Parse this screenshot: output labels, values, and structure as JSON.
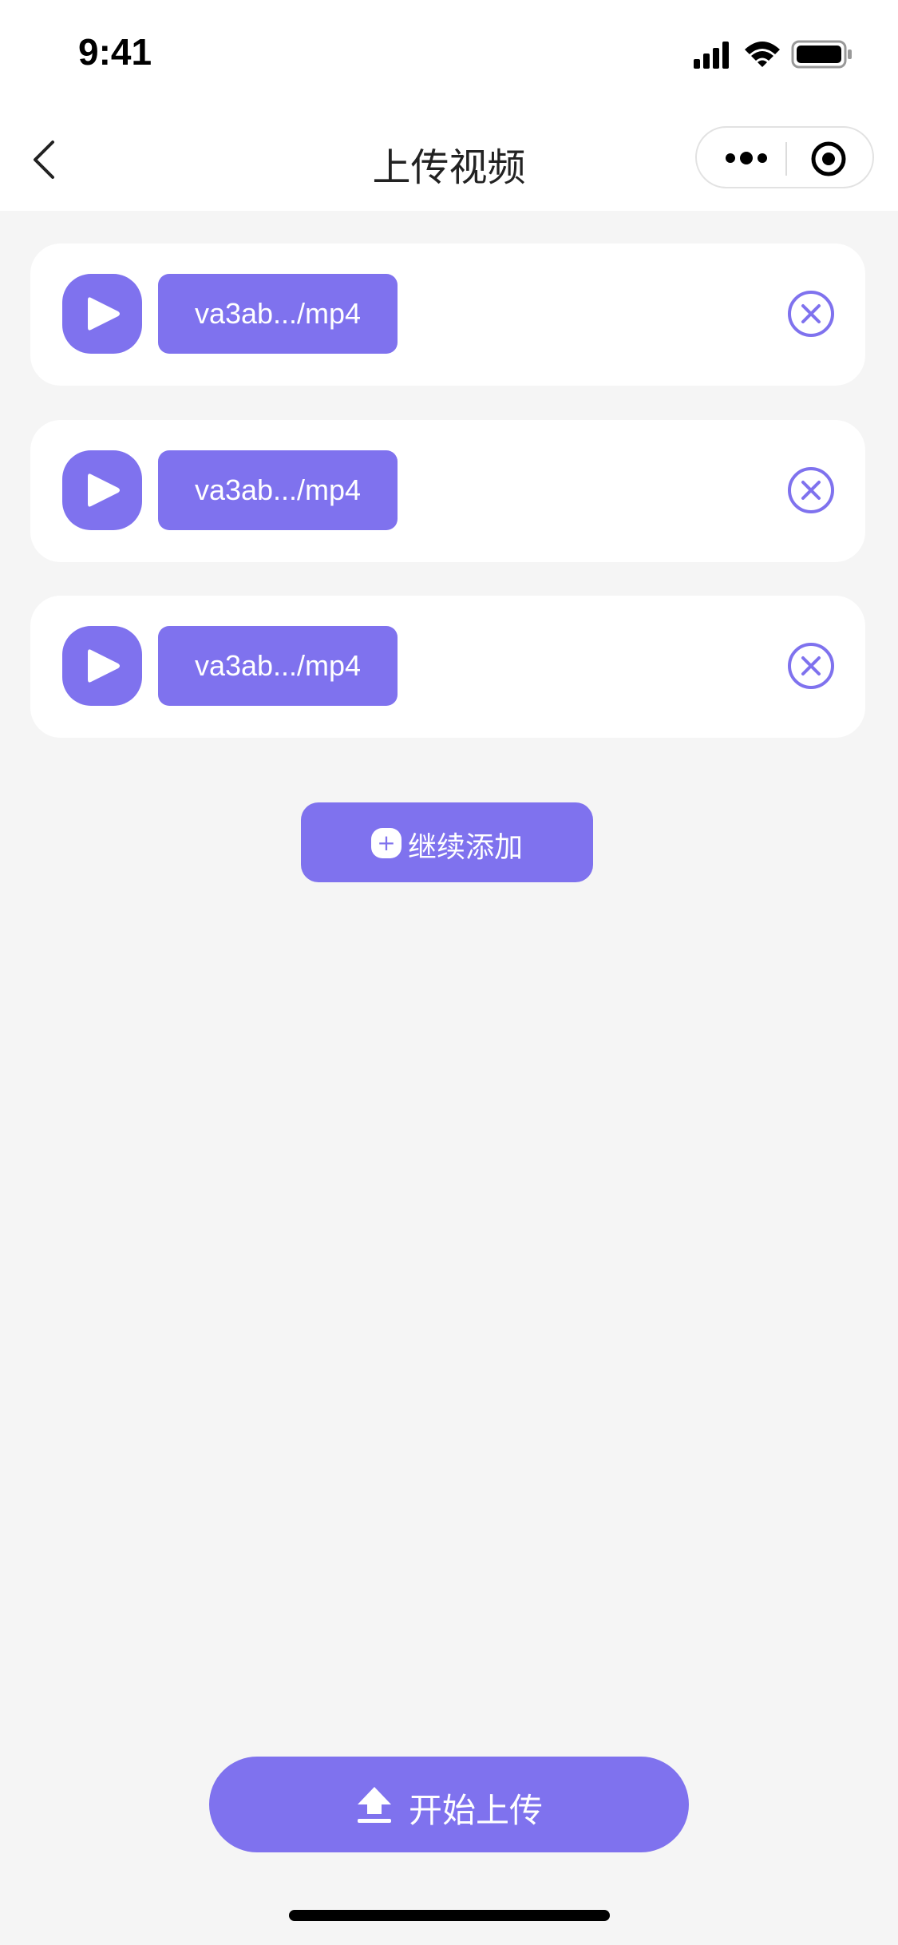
{
  "status_bar": {
    "time": "9:41"
  },
  "nav": {
    "title": "上传视频"
  },
  "files": [
    {
      "name": "va3ab.../mp4"
    },
    {
      "name": "va3ab.../mp4"
    },
    {
      "name": "va3ab.../mp4"
    }
  ],
  "actions": {
    "add_more_label": "继续添加",
    "add_more_plus": "+",
    "start_upload_label": "开始上传"
  },
  "colors": {
    "accent": "#7f72ee",
    "background": "#f5f5f5"
  },
  "icons": [
    "back-arrow-icon",
    "more-dots-icon",
    "mini-program-close-icon",
    "play-icon",
    "remove-circle-x-icon",
    "plus-icon",
    "upload-arrow-icon",
    "signal-icon",
    "wifi-icon",
    "battery-icon"
  ]
}
